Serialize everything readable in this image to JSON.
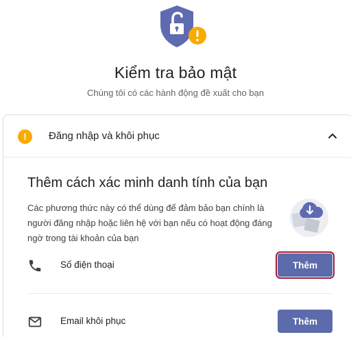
{
  "header": {
    "title": "Kiểm tra bảo mật",
    "subtitle": "Chúng tôi có các hành động đề xuất cho bạn",
    "shield_icon": "shield-unlock-warning-icon"
  },
  "section": {
    "label": "Đăng nhập và khôi phục",
    "status_icon": "warning-icon",
    "expanded": true
  },
  "content": {
    "title": "Thêm cách xác minh danh tính của bạn",
    "description": "Các phương thức này có thể dùng để đảm bảo bạn chính là người đăng nhập hoặc liên hệ với bạn nếu có hoạt động đáng ngờ trong tài khoản của bạn"
  },
  "methods": [
    {
      "label": "Số điện thoại",
      "icon": "phone-icon",
      "button_label": "Thêm",
      "highlighted": true
    },
    {
      "label": "Email khôi phục",
      "icon": "mail-icon",
      "button_label": "Thêm",
      "highlighted": false
    }
  ],
  "colors": {
    "accent_button": "#5c6bab",
    "highlight_border": "#9e1a34",
    "shield": "#5f6bb0",
    "warning": "#f9ab00"
  }
}
